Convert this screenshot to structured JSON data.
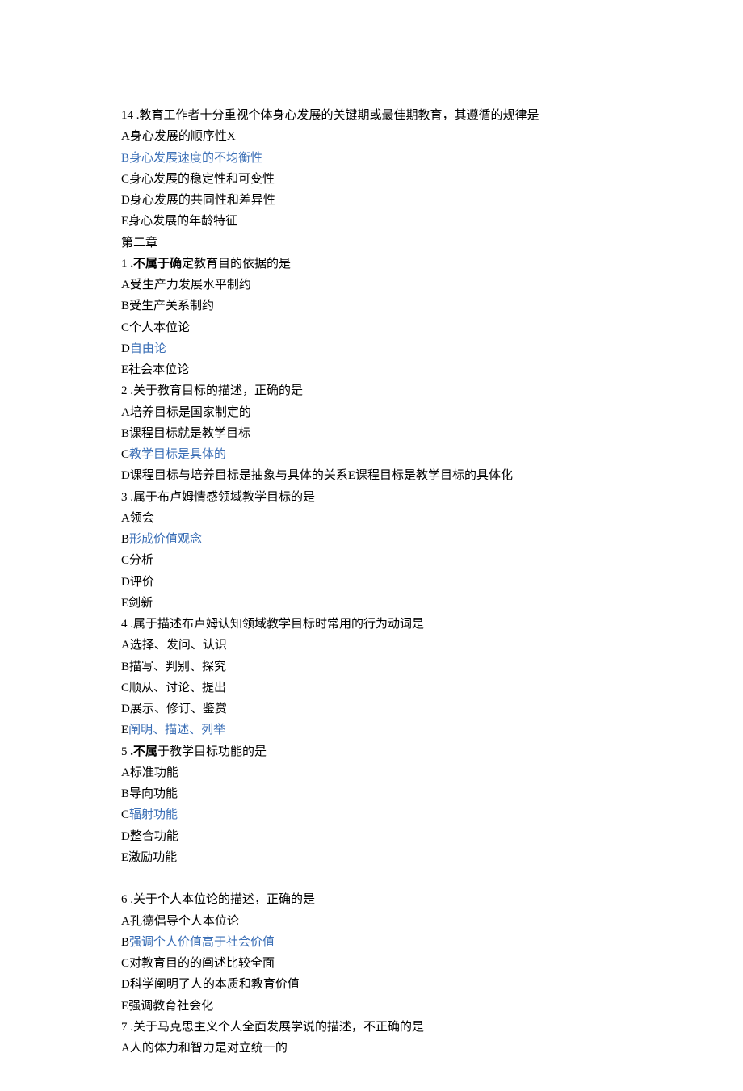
{
  "q14": {
    "num": "14",
    "stem": " .教育工作者十分重视个体身心发展的关键期或最佳期教育，其遵循的规律是",
    "A": "A身心发展的顺序性X",
    "B": "B身心发展速度的不均衡性",
    "C": "C身心发展的稳定性和可变性",
    "D": "D身心发展的共同性和差异性",
    "E": "E身心发展的年龄特征"
  },
  "chapter_heading": "第二章",
  "c2q1": {
    "num": "1",
    "stem_bold": " .不属于确",
    "stem_rest": "定教育目的依据的是",
    "A": "A受生产力发展水平制约",
    "B": "B受生产关系制约",
    "C": "C个人本位论",
    "D_pre": "D",
    "D_hl": "自由论",
    "E": "E社会本位论"
  },
  "c2q2": {
    "num": "2",
    "stem": " .关于教育目标的描述，正确的是",
    "A": "A培养目标是国家制定的",
    "B": "B课程目标就是教学目标",
    "C_pre": "C",
    "C_hl": "教学目标是具体的",
    "D": "D课程目标与培养目标是抽象与具体的关系E课程目标是教学目标的具体化"
  },
  "c2q3": {
    "num": "3",
    "stem": " .属于布卢姆情感领域教学目标的是",
    "A": "A领会",
    "B_pre": "B",
    "B_hl": "形成价值观念",
    "C": "C分析",
    "D": "D评价",
    "E": "E剑新"
  },
  "c2q4": {
    "num": "4",
    "stem": " .属于描述布卢姆认知领域教学目标时常用的行为动词是",
    "A": "A选择、发问、认识",
    "B": "B描写、判别、探究",
    "C": "C顺从、讨论、提出",
    "D": "D展示、修订、鉴赏",
    "E_pre": "E",
    "E_hl": "阐明、描述、列举"
  },
  "c2q5": {
    "num": "5",
    "stem_bold": " .不属",
    "stem_rest": "于教学目标功能的是",
    "A": "A标准功能",
    "B": "B导向功能",
    "C_pre": "C",
    "C_hl": "辐射功能",
    "D": "D整合功能",
    "E": "E激励功能"
  },
  "c2q6": {
    "num": "6",
    "stem": " .关于个人本位论的描述，正确的是",
    "A": "A孔德倡导个人本位论",
    "B_pre": "B",
    "B_hl": "强调个人价值高于社会价值",
    "C": "C对教育目的的阐述比较全面",
    "D": "D科学阐明了人的本质和教育价值",
    "E": "E强调教育社会化"
  },
  "c2q7": {
    "num": "7",
    "stem": " .关于马克思主义个人全面发展学说的描述，不正确的是",
    "A": "A人的体力和智力是对立统一的"
  }
}
